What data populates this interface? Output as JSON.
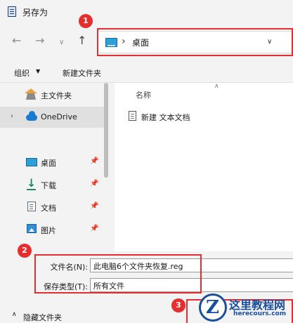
{
  "window": {
    "title": "另存为"
  },
  "address": {
    "location": "桌面"
  },
  "toolbar": {
    "organize_label": "组织",
    "new_folder_label": "新建文件夹"
  },
  "sidebar": {
    "items": [
      {
        "label": "主文件夹",
        "icon": "home-icon"
      },
      {
        "label": "OneDrive",
        "icon": "cloud-icon"
      },
      {
        "label": "桌面",
        "icon": "desktop-icon"
      },
      {
        "label": "下载",
        "icon": "download-icon"
      },
      {
        "label": "文档",
        "icon": "document-icon"
      },
      {
        "label": "图片",
        "icon": "picture-icon"
      }
    ]
  },
  "file_list": {
    "column_name": "名称",
    "files": [
      {
        "name": "新建 文本文档"
      }
    ]
  },
  "save_form": {
    "filename_label": "文件名(N):",
    "filename_value": "此电脑6个文件夹恢复.reg",
    "filetype_label": "保存类型(T):",
    "filetype_value": "所有文件"
  },
  "footer": {
    "hide_folders_label": "隐藏文件夹"
  },
  "annotations": {
    "badge_1": "1",
    "badge_2": "2",
    "badge_3": "3"
  },
  "watermark": {
    "title": "这里教程网",
    "url": "herecours.com",
    "letter": "Z"
  },
  "colors": {
    "annotation_red": "#e62e2e",
    "watermark_blue": "#1a4fa0"
  }
}
